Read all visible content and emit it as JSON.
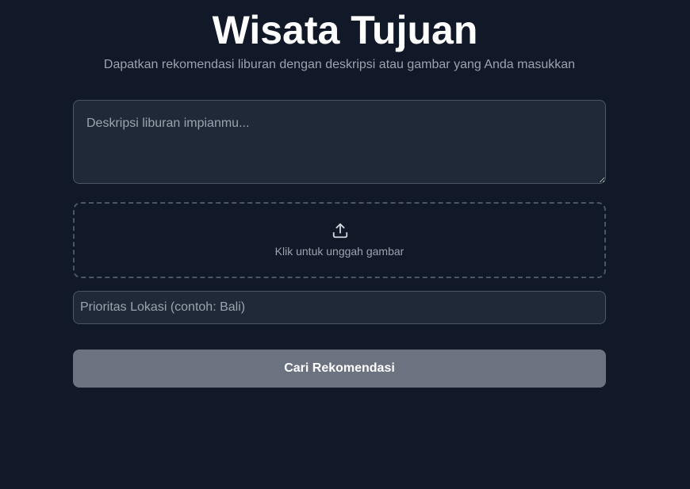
{
  "header": {
    "title": "Wisata Tujuan",
    "subtitle": "Dapatkan rekomendasi liburan dengan deskripsi atau gambar yang Anda masukkan"
  },
  "form": {
    "description": {
      "value": "",
      "placeholder": "Deskripsi liburan impianmu..."
    },
    "upload": {
      "icon": "upload-icon",
      "label": "Klik untuk unggah gambar"
    },
    "location": {
      "value": "",
      "placeholder": "Prioritas Lokasi (contoh: Bali)"
    },
    "submit_label": "Cari Rekomendasi"
  },
  "colors": {
    "background": "#111827",
    "field_background": "#1f2937",
    "border": "#4b5563",
    "muted_text": "#9ca3af",
    "button": "#6b7280"
  }
}
